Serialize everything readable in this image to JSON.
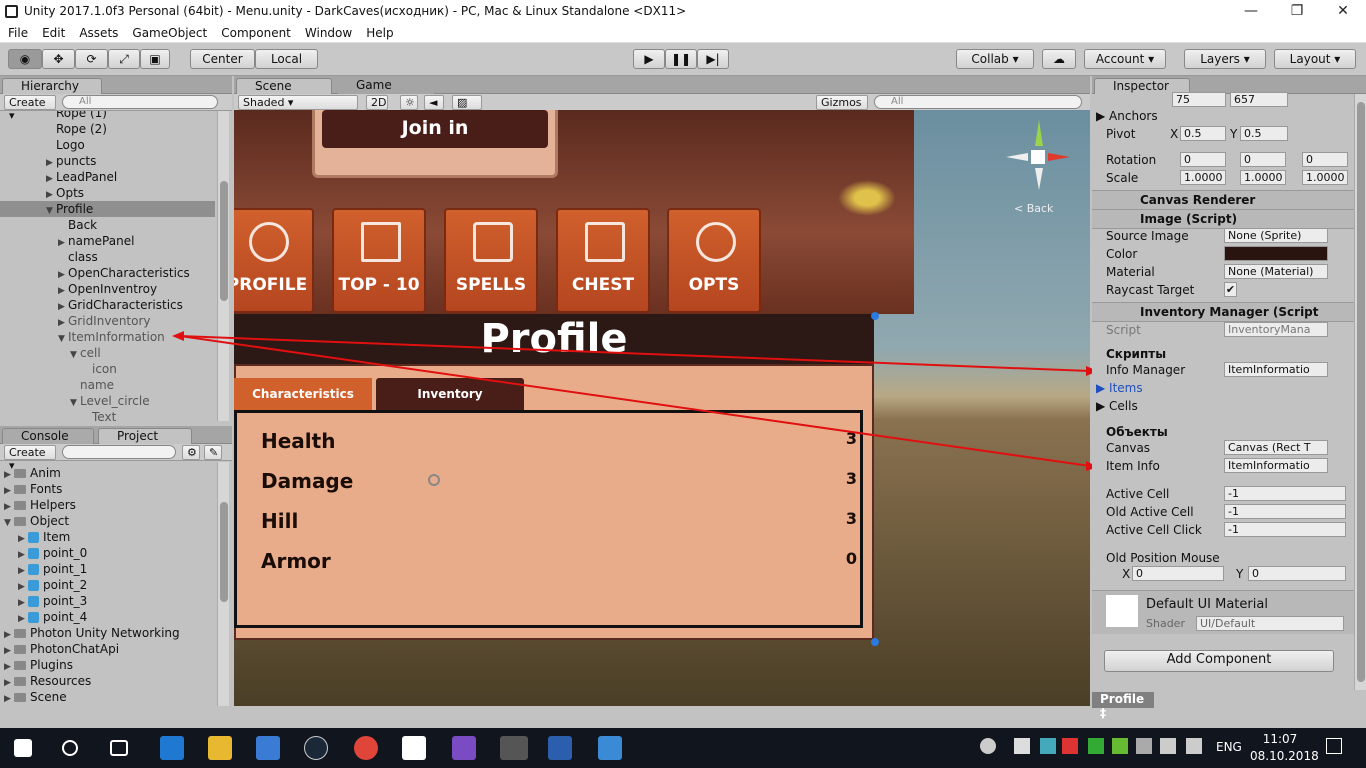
{
  "window": {
    "title": "Unity 2017.1.0f3 Personal (64bit) - Menu.unity - DarkCaves(исходник) - PC, Mac & Linux Standalone <DX11>"
  },
  "menu": [
    "File",
    "Edit",
    "Assets",
    "GameObject",
    "Component",
    "Window",
    "Help"
  ],
  "toolbar": {
    "center": "Center",
    "local": "Local",
    "collab": "Collab ▾",
    "account": "Account",
    "layers": "Layers",
    "layout": "Layout"
  },
  "hierarchy": {
    "tab": "Hierarchy",
    "create": "Create ▾",
    "search": "All",
    "rows": [
      {
        "label": "Rope (1)",
        "indent": 3,
        "arrow": ""
      },
      {
        "label": "Rope (2)",
        "indent": 3,
        "arrow": ""
      },
      {
        "label": "Logo",
        "indent": 3,
        "arrow": ""
      },
      {
        "label": "puncts",
        "indent": 3,
        "arrow": "▶"
      },
      {
        "label": "LeadPanel",
        "indent": 3,
        "arrow": "▶"
      },
      {
        "label": "Opts",
        "indent": 3,
        "arrow": "▶"
      },
      {
        "label": "Profile",
        "indent": 3,
        "arrow": "▼",
        "selected": true
      },
      {
        "label": "Back",
        "indent": 4,
        "arrow": ""
      },
      {
        "label": "namePanel",
        "indent": 4,
        "arrow": "▶"
      },
      {
        "label": "class",
        "indent": 4,
        "arrow": ""
      },
      {
        "label": "OpenCharacteristics",
        "indent": 4,
        "arrow": "▶"
      },
      {
        "label": "OpenInventroy",
        "indent": 4,
        "arrow": "▶"
      },
      {
        "label": "GridCharacteristics",
        "indent": 4,
        "arrow": "▶"
      },
      {
        "label": "GridInventory",
        "indent": 4,
        "arrow": "▶",
        "dim": true
      },
      {
        "label": "ItemInformation",
        "indent": 4,
        "arrow": "▼",
        "dim": true
      },
      {
        "label": "cell",
        "indent": 5,
        "arrow": "▼",
        "dim": true
      },
      {
        "label": "icon",
        "indent": 6,
        "arrow": "",
        "dim": true
      },
      {
        "label": "name",
        "indent": 5,
        "arrow": "",
        "dim": true
      },
      {
        "label": "Level_circle",
        "indent": 5,
        "arrow": "▼",
        "dim": true
      },
      {
        "label": "Text",
        "indent": 6,
        "arrow": "",
        "dim": true
      }
    ]
  },
  "project": {
    "tabs": [
      "Console",
      "Project"
    ],
    "create": "Create ▾",
    "rows": [
      {
        "label": "Anim",
        "indent": 0,
        "type": "folder"
      },
      {
        "label": "Fonts",
        "indent": 0,
        "type": "folder"
      },
      {
        "label": "Helpers",
        "indent": 0,
        "type": "folder"
      },
      {
        "label": "Object",
        "indent": 0,
        "type": "folder",
        "open": true
      },
      {
        "label": "Item",
        "indent": 1,
        "type": "prefab"
      },
      {
        "label": "point_0",
        "indent": 1,
        "type": "prefab"
      },
      {
        "label": "point_1",
        "indent": 1,
        "type": "prefab"
      },
      {
        "label": "point_2",
        "indent": 1,
        "type": "prefab"
      },
      {
        "label": "point_3",
        "indent": 1,
        "type": "prefab"
      },
      {
        "label": "point_4",
        "indent": 1,
        "type": "prefab"
      },
      {
        "label": "Photon Unity Networking",
        "indent": 0,
        "type": "folder"
      },
      {
        "label": "PhotonChatApi",
        "indent": 0,
        "type": "folder"
      },
      {
        "label": "Plugins",
        "indent": 0,
        "type": "folder"
      },
      {
        "label": "Resources",
        "indent": 0,
        "type": "folder"
      },
      {
        "label": "Scene",
        "indent": 0,
        "type": "folder"
      }
    ]
  },
  "scene": {
    "tabs": [
      "Scene",
      "Game"
    ],
    "shaded": "Shaded",
    "mode2d": "2D",
    "gizmos": "Gizmos ▾",
    "search": "All",
    "back": "< Back",
    "join": "Join in",
    "buttons": [
      "PROFILE",
      "TOP - 10",
      "SPELLS",
      "CHEST",
      "OPTS"
    ],
    "profile_title": "Profile",
    "subtabs": [
      "Characteristics",
      "Inventory"
    ],
    "stats": [
      {
        "name": "Health",
        "value": "3"
      },
      {
        "name": "Damage",
        "value": "3"
      },
      {
        "name": "Hill",
        "value": "3"
      },
      {
        "name": "Armor",
        "value": "0"
      }
    ]
  },
  "inspector": {
    "tab": "Inspector",
    "top_w": "75",
    "top_h": "657",
    "anchors": "Anchors",
    "pivot": {
      "label": "Pivot",
      "x": "0.5",
      "y": "0.5"
    },
    "rotation": {
      "label": "Rotation",
      "x": "0",
      "y": "0",
      "z": "0"
    },
    "scale": {
      "label": "Scale",
      "x": "1.0000",
      "y": "1.0000",
      "z": "1.0000"
    },
    "canvas_renderer": "Canvas Renderer",
    "image_script": "Image (Script)",
    "source_image": {
      "label": "Source Image",
      "value": "None (Sprite)"
    },
    "color": {
      "label": "Color"
    },
    "material": {
      "label": "Material",
      "value": "None (Material)"
    },
    "raycast": {
      "label": "Raycast Target"
    },
    "inv_manager": "Inventory Manager (Script",
    "script": {
      "label": "Script",
      "value": "InventoryMana"
    },
    "section_scripts": "Скрипты",
    "info_manager": {
      "label": "Info Manager",
      "value": "ItemInformatio"
    },
    "items": "Items",
    "cells": "Cells",
    "section_objects": "Объекты",
    "canvas": {
      "label": "Canvas",
      "value": "Canvas (Rect T"
    },
    "item_info": {
      "label": "Item Info",
      "value": "ItemInformatio"
    },
    "active_cell": {
      "label": "Active Cell",
      "value": "-1"
    },
    "old_active_cell": {
      "label": "Old Active Cell",
      "value": "-1"
    },
    "active_cell_click": {
      "label": "Active Cell Click",
      "value": "-1"
    },
    "old_pos": {
      "label": "Old Position Mouse",
      "x": "0",
      "y": "0"
    },
    "default_mat": "Default UI Material",
    "shader": {
      "label": "Shader",
      "value": "UI/Default"
    },
    "add_component": "Add Component",
    "footer": "Profile ‡"
  },
  "taskbar": {
    "lang": "ENG",
    "time": "11:07",
    "date": "08.10.2018"
  },
  "colors": {
    "accent_blue": "#3a72d0",
    "selection": "#8f8f8f",
    "arrow_red": "#e01010",
    "button_orange": "#c9552a"
  }
}
